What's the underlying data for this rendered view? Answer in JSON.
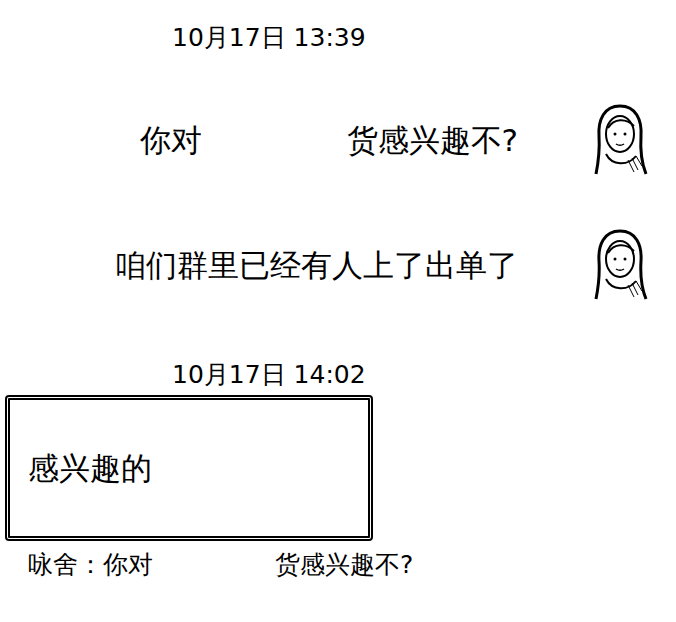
{
  "messages": [
    {
      "kind": "time",
      "text": "10月17日 13:39"
    },
    {
      "kind": "incoming",
      "parts": [
        "你对",
        "货感兴趣不?"
      ]
    },
    {
      "kind": "incoming",
      "parts": [
        "咱们群里已经有人上了出单了"
      ]
    },
    {
      "kind": "time",
      "text": "10月17日 14:02"
    },
    {
      "kind": "reply",
      "text": "感兴趣的",
      "quote": {
        "sender": "咏舍：",
        "parts": [
          "你对",
          "货感兴趣不?"
        ]
      }
    }
  ]
}
